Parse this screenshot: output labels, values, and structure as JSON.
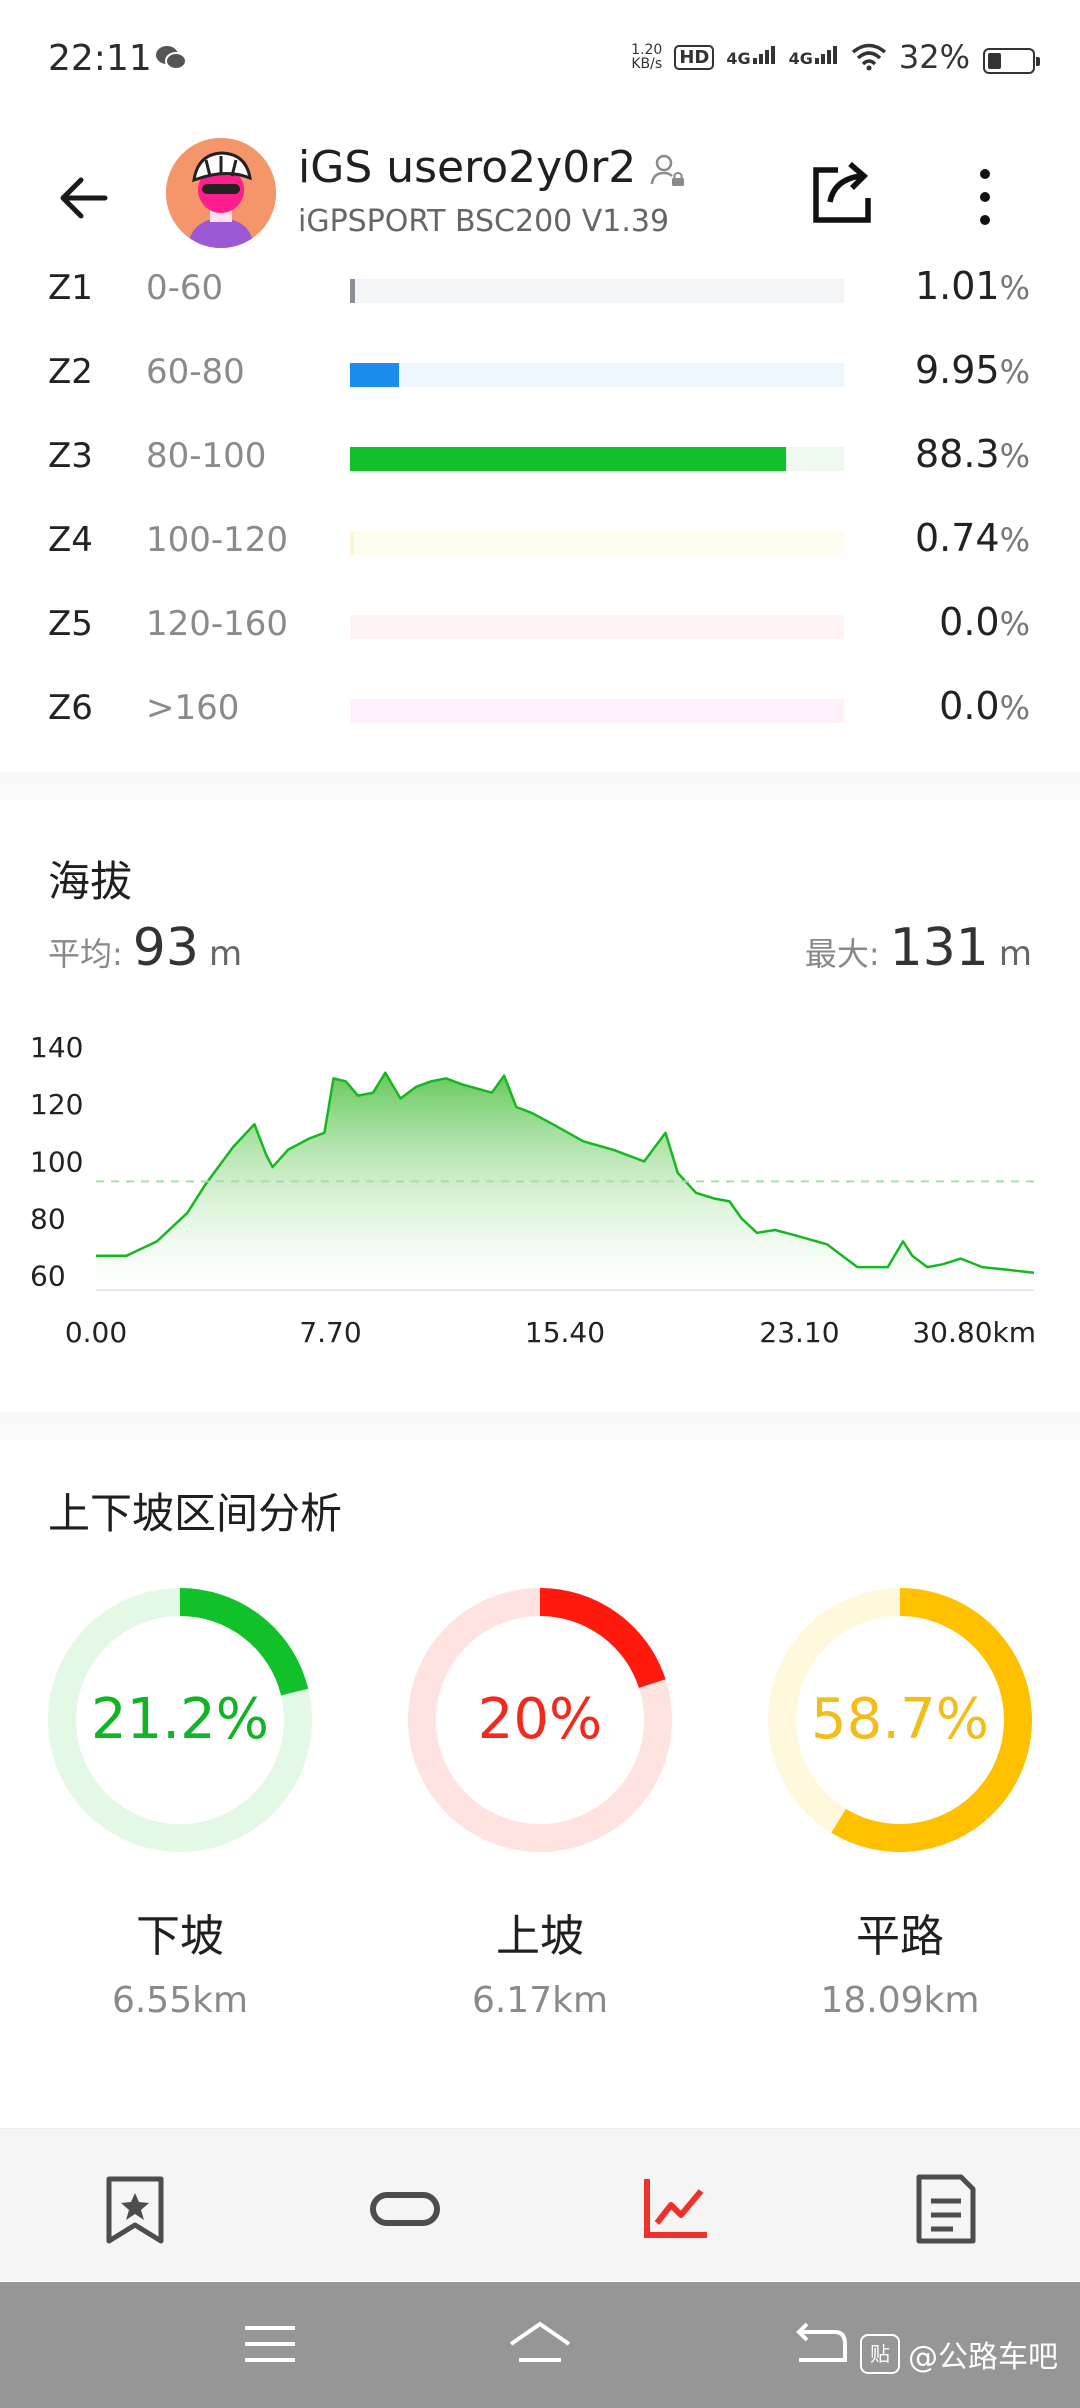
{
  "status_bar": {
    "time": "22:11",
    "net_speed_value": "1.20",
    "net_speed_unit": "KB/s",
    "hd_badge": "HD",
    "network_1": "4G",
    "network_2": "4G",
    "battery": "32%"
  },
  "header": {
    "title": "iGS usero2y0r2",
    "subtitle": "iGPSPORT BSC200  V1.39"
  },
  "zones": [
    {
      "name": "Z1",
      "range": "0-60",
      "value": "1.01",
      "unit": "%",
      "fraction": 0.0101,
      "color": "#8a8f95",
      "track": "#f3f5f6"
    },
    {
      "name": "Z2",
      "range": "60-80",
      "value": "9.95",
      "unit": "%",
      "fraction": 0.0995,
      "color": "#1a8cf0",
      "track": "#eef7fd"
    },
    {
      "name": "Z3",
      "range": "80-100",
      "value": "88.3",
      "unit": "%",
      "fraction": 0.883,
      "color": "#10c12a",
      "track": "#eefaf0"
    },
    {
      "name": "Z4",
      "range": "100-120",
      "value": "0.74",
      "unit": "%",
      "fraction": 0.0074,
      "color": "#fff6cf",
      "track": "#fffdf0"
    },
    {
      "name": "Z5",
      "range": "120-160",
      "value": "0.0",
      "unit": "%",
      "fraction": 0,
      "color": "#ffd6d6",
      "track": "#fff3f3"
    },
    {
      "name": "Z6",
      "range": ">160",
      "value": "0.0",
      "unit": "%",
      "fraction": 0,
      "color": "#ffd6f3",
      "track": "#fff1fb"
    }
  ],
  "altitude": {
    "title": "海拔",
    "avg_label": "平均:",
    "avg_value": "93",
    "avg_unit": "m",
    "max_label": "最大:",
    "max_value": "131",
    "max_unit": "m"
  },
  "chart_data": {
    "type": "area",
    "color": "#13b91e",
    "ylim": [
      55,
      140
    ],
    "xlim": [
      0,
      30.8
    ],
    "y_ticks": [
      "140",
      "120",
      "100",
      "80",
      "60"
    ],
    "x_ticks": [
      "0.00",
      "7.70",
      "15.40",
      "23.10",
      "30.80km"
    ],
    "avg_line": 93,
    "x": [
      0,
      1,
      2,
      3,
      3.6,
      4.5,
      5.2,
      5.6,
      5.8,
      6.3,
      7,
      7.5,
      7.8,
      8.2,
      8.6,
      9.1,
      9.5,
      10,
      10.5,
      11,
      11.5,
      12,
      13,
      13.4,
      13.8,
      14.3,
      15,
      16,
      17,
      18,
      18.7,
      19.1,
      19.7,
      20.3,
      20.8,
      21.2,
      21.7,
      22.3,
      23,
      24,
      25,
      26,
      26.5,
      26.8,
      27.3,
      27.8,
      28.4,
      29.1,
      30,
      30.8
    ],
    "y": [
      67,
      67,
      72,
      82,
      92,
      105,
      113,
      102,
      98,
      104,
      108,
      110,
      129,
      128,
      123,
      124,
      131,
      122,
      126,
      128,
      129,
      127,
      124,
      130,
      119,
      117,
      113,
      107,
      104,
      100,
      110,
      96,
      89,
      87,
      86,
      80,
      75,
      76,
      74,
      71,
      63,
      63,
      72,
      67,
      63,
      64,
      66,
      63,
      62,
      61
    ]
  },
  "updown": {
    "title": "上下坡区间分析",
    "items": [
      {
        "pct": "21.2%",
        "fraction": 0.212,
        "label": "下坡",
        "distance": "6.55km",
        "color": "#10c12a",
        "track": "#e4f8e6",
        "text_color": "#10b424"
      },
      {
        "pct": "20%",
        "fraction": 0.2,
        "label": "上坡",
        "distance": "6.17km",
        "color": "#ff1a0d",
        "track": "#ffe3e1",
        "text_color": "#f2291e"
      },
      {
        "pct": "58.7%",
        "fraction": 0.587,
        "label": "平路",
        "distance": "18.09km",
        "color": "#ffc000",
        "track": "#fff8dd",
        "text_color": "#f2bd1a"
      }
    ]
  },
  "tabs": [
    {
      "icon": "bookmark-star-icon",
      "active": false
    },
    {
      "icon": "loop-icon",
      "active": false
    },
    {
      "icon": "trend-chart-icon",
      "active": true
    },
    {
      "icon": "document-list-icon",
      "active": false
    }
  ],
  "watermark": {
    "logo": "贴",
    "text": "@公路车吧"
  }
}
